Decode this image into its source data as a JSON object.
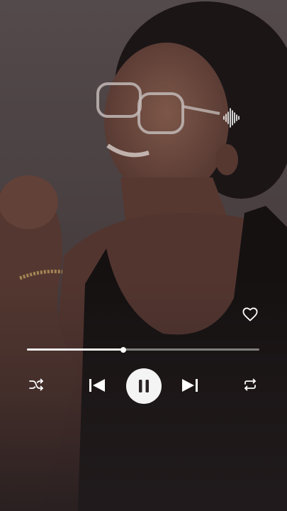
{
  "player": {
    "progress_fraction": 0.414,
    "is_playing": true,
    "favorited": false
  },
  "icons": {
    "waveform": "waveform-icon",
    "favorite": "heart-outline-icon",
    "shuffle": "shuffle-icon",
    "previous": "skip-previous-icon",
    "play_pause": "pause-icon",
    "next": "skip-next-icon",
    "repeat": "repeat-icon"
  },
  "colors": {
    "control_fg": "#ffffff",
    "track_bg": "#9c9596",
    "track_fill": "#f2f2f2",
    "play_button_bg": "#f4f4f4",
    "play_icon": "#2a2426"
  }
}
